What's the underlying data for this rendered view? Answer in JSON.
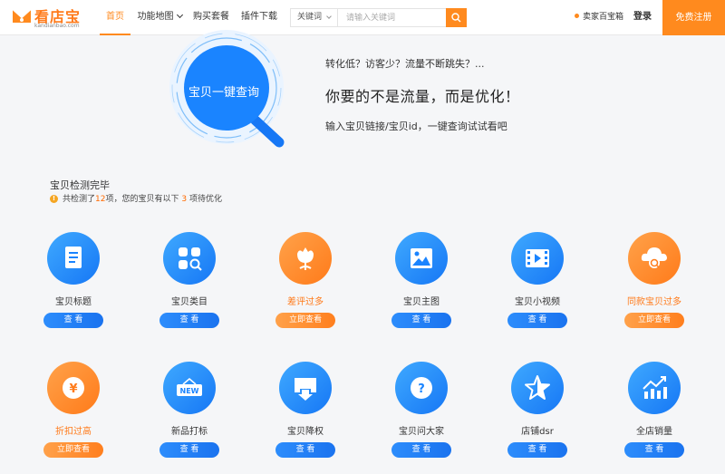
{
  "header": {
    "logo_text": "看店宝",
    "logo_sub": "kandianbao.com",
    "nav": {
      "home": "首页",
      "feature_map": "功能地图",
      "buy_package": "购买套餐",
      "plugin_download": "插件下载"
    },
    "search": {
      "select_value": "关键词",
      "placeholder": "请输入关键词",
      "icon": "search-icon"
    },
    "seller_box": "卖家百宝箱",
    "login": "登录",
    "register": "免费注册",
    "accent_color": "#ff8a1e"
  },
  "hero": {
    "circle_label": "宝贝一键查询",
    "question": "转化低？访客少？流量不断跳失？...",
    "headline": "你要的不是流量，而是优化！",
    "tip": "输入宝贝链接/宝贝id，一键查询试试看吧"
  },
  "result": {
    "title": "宝贝检测完毕",
    "info_prefix": "共检测了",
    "checked_count": "12",
    "info_middle": "项，您的宝贝有以下",
    "issue_count": "3",
    "info_suffix": "项待优化"
  },
  "items": [
    {
      "label": "宝贝标题",
      "button": "查 看",
      "status": "ok",
      "icon": "document-icon"
    },
    {
      "label": "宝贝类目",
      "button": "查 看",
      "status": "ok",
      "icon": "category-grid-icon"
    },
    {
      "label": "差评过多",
      "button": "立即查看",
      "status": "warn",
      "icon": "flower-icon"
    },
    {
      "label": "宝贝主图",
      "button": "查 看",
      "status": "ok",
      "icon": "image-icon"
    },
    {
      "label": "宝贝小视频",
      "button": "查 看",
      "status": "ok",
      "icon": "video-icon"
    },
    {
      "label": "同款宝贝过多",
      "button": "立即查看",
      "status": "warn",
      "icon": "cloud-search-icon"
    },
    {
      "label": "折扣过高",
      "button": "立即查看",
      "status": "warn",
      "icon": "yen-coin-icon"
    },
    {
      "label": "新品打标",
      "button": "查 看",
      "status": "ok",
      "icon": "new-tag-icon"
    },
    {
      "label": "宝贝降权",
      "button": "查 看",
      "status": "ok",
      "icon": "download-box-icon"
    },
    {
      "label": "宝贝问大家",
      "button": "查 看",
      "status": "ok",
      "icon": "question-icon"
    },
    {
      "label": "店铺dsr",
      "button": "查 看",
      "status": "ok",
      "icon": "star-icon"
    },
    {
      "label": "全店销量",
      "button": "查 看",
      "status": "ok",
      "icon": "trend-chart-icon"
    }
  ],
  "colors": {
    "ok_blue": "#1677f5",
    "warn_orange": "#ff7b1a"
  }
}
